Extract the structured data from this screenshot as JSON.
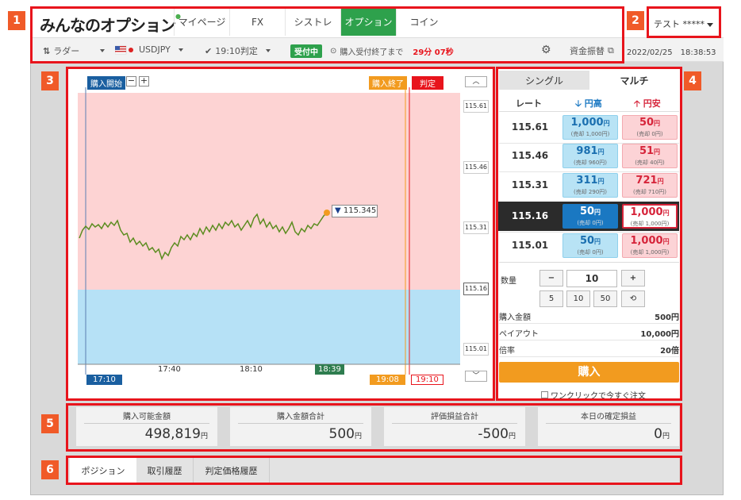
{
  "brand": {
    "logo": "みんなのオプション"
  },
  "nav": {
    "items": [
      "マイページ",
      "FX",
      "シストレ",
      "オプション",
      "コイン"
    ],
    "active_index": 3
  },
  "user": {
    "name": "テスト *****"
  },
  "toolbar": {
    "ladder": "ラダー",
    "pair": "USDJPY",
    "judgment": "19:10判定",
    "status": "受付中",
    "until_label": "購入受付終了まで",
    "countdown": "29分 07秒",
    "transfer": "資金振替",
    "datetime": "2022/02/25　18:38:53"
  },
  "chart": {
    "purchase_start": "購入開始",
    "purchase_end": "購入終了",
    "judgment": "判定",
    "minus": "−",
    "plus": "+",
    "current_price": "115.345",
    "y_ticks": [
      "115.61",
      "115.46",
      "115.31",
      "115.16",
      "115.01"
    ],
    "x_ticks": [
      "17:10",
      "17:40",
      "18:10",
      "18:39",
      "19:08",
      "19:10"
    ]
  },
  "trade": {
    "tabs": [
      "シングル",
      "マルチ"
    ],
    "active_tab": 1,
    "headers": {
      "rate": "レート",
      "down": "円高",
      "up": "円安"
    },
    "rows": [
      {
        "rate": "115.61",
        "down": "1,000",
        "down_sub": "(売却 1,000円)",
        "up": "50",
        "up_sub": "(売却 0円)"
      },
      {
        "rate": "115.46",
        "down": "981",
        "down_sub": "(売却 960円)",
        "up": "51",
        "up_sub": "(売却 40円)"
      },
      {
        "rate": "115.31",
        "down": "311",
        "down_sub": "(売却 290円)",
        "up": "721",
        "up_sub": "(売却 710円)"
      },
      {
        "rate": "115.16",
        "down": "50",
        "down_sub": "(売却 0円)",
        "up": "1,000",
        "up_sub": "(売却 1,000円)"
      },
      {
        "rate": "115.01",
        "down": "50",
        "down_sub": "(売却 0円)",
        "up": "1,000",
        "up_sub": "(売却 1,000円)"
      }
    ],
    "yen_unit": "円",
    "quantity_label": "数量",
    "quantity": "10",
    "minus": "−",
    "plus": "+",
    "presets": [
      "5",
      "10",
      "50"
    ],
    "reset_icon": "⟲",
    "purchase_amount_label": "購入金額",
    "purchase_amount": "500円",
    "payout_label": "ペイアウト",
    "payout": "10,000円",
    "multiplier_label": "倍率",
    "multiplier": "20倍",
    "buy": "購入",
    "oneclick": "ワンクリックで今すぐ注文"
  },
  "summary": [
    {
      "label": "購入可能金額",
      "value": "498,819"
    },
    {
      "label": "購入金額合計",
      "value": "500"
    },
    {
      "label": "評価損益合計",
      "value": "-500"
    },
    {
      "label": "本日の確定損益",
      "value": "0"
    }
  ],
  "bottom_tabs": [
    "ポジション",
    "取引履歴",
    "判定価格履歴"
  ],
  "badges": [
    "1",
    "2",
    "3",
    "4",
    "5",
    "6"
  ]
}
